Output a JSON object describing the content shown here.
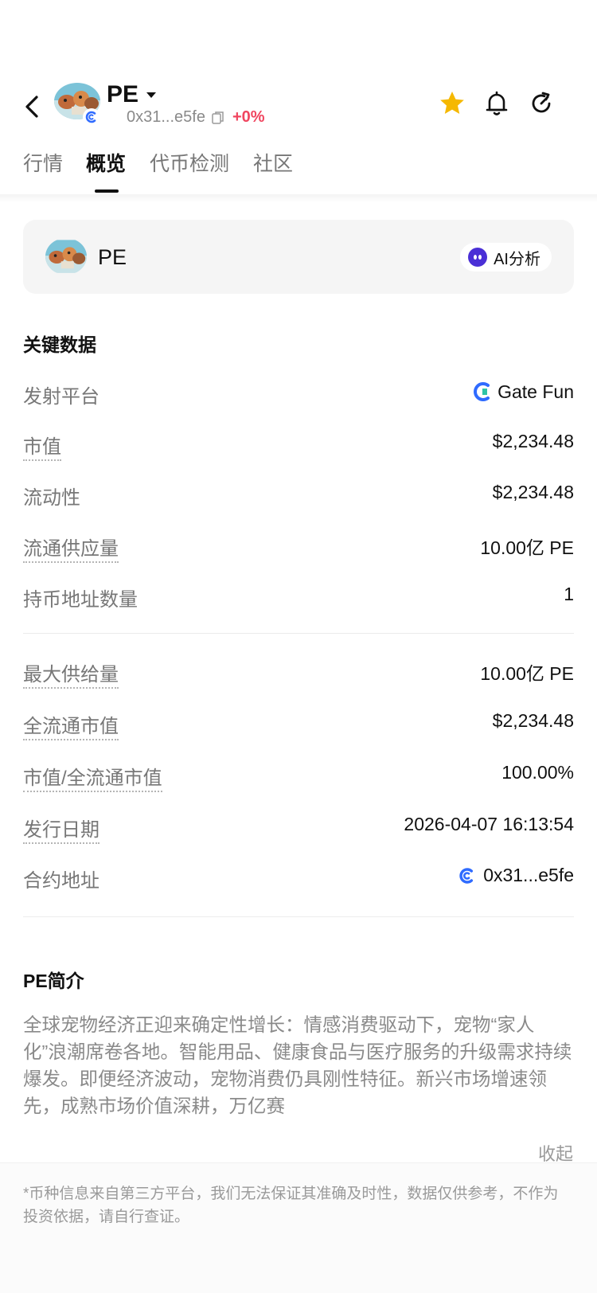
{
  "header": {
    "symbol": "PE",
    "address": "0x31...e5fe",
    "change": "+0%"
  },
  "tabs": [
    {
      "label": "行情"
    },
    {
      "label": "概览"
    },
    {
      "label": "代币检测"
    },
    {
      "label": "社区"
    }
  ],
  "token_card": {
    "symbol": "PE",
    "ai_label": "AI分析"
  },
  "key_data": {
    "title": "关键数据",
    "rows": [
      {
        "label": "发射平台",
        "value": "Gate Fun"
      },
      {
        "label": "市值",
        "value": "$2,234.48"
      },
      {
        "label": "流动性",
        "value": "$2,234.48"
      },
      {
        "label": "流通供应量",
        "value": "10.00亿 PE"
      },
      {
        "label": "持币地址数量",
        "value": "1"
      },
      {
        "label": "最大供给量",
        "value": "10.00亿 PE"
      },
      {
        "label": "全流通市值",
        "value": "$2,234.48"
      },
      {
        "label": "市值/全流通市值",
        "value": "100.00%"
      },
      {
        "label": "发行日期",
        "value": "2026-04-07 16:13:54"
      },
      {
        "label": "合约地址",
        "value": "0x31...e5fe"
      }
    ]
  },
  "intro": {
    "title": "PE简介",
    "text": "全球宠物经济正迎来确定性增长：情感消费驱动下，宠物“家人化”浪潮席卷各地。智能用品、健康食品与医疗服务的升级需求持续爆发。即便经济波动，宠物消费仍具刚性特征。新兴市场增速领先，成熟市场价值深耕，万亿赛",
    "collapse_label": "收起"
  },
  "disclaimer": "*币种信息来自第三方平台，我们无法保证其准确及时性，数据仅供参考，不作为投资依据，请自行查证。",
  "colors": {
    "positive": "#f0455f",
    "star": "#f5b800",
    "ai": "#4a2fd6",
    "gate": "#2f6bff"
  },
  "icons": [
    "back-arrow-icon",
    "caret-down-icon",
    "copy-icon",
    "star-icon",
    "bell-icon",
    "refresh-icon",
    "robot-icon",
    "gate-fun-logo-icon",
    "chain-icon"
  ]
}
